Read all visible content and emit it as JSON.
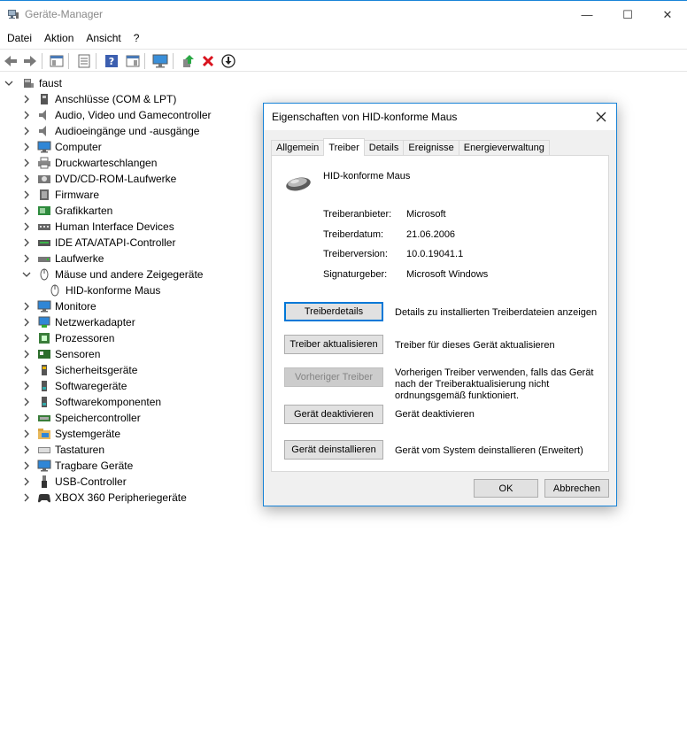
{
  "window": {
    "title": "Geräte-Manager",
    "controls": {
      "minimize": "—",
      "maximize": "☐",
      "close": "✕"
    }
  },
  "menu": [
    "Datei",
    "Aktion",
    "Ansicht",
    "?"
  ],
  "tree": {
    "root": "faust",
    "items": [
      {
        "label": "Anschlüsse (COM & LPT)",
        "icon": "port-icon"
      },
      {
        "label": "Audio, Video und Gamecontroller",
        "icon": "speaker-icon"
      },
      {
        "label": "Audioeingänge und -ausgänge",
        "icon": "speaker-icon"
      },
      {
        "label": "Computer",
        "icon": "monitor-icon"
      },
      {
        "label": "Druckwarteschlangen",
        "icon": "printer-icon"
      },
      {
        "label": "DVD/CD-ROM-Laufwerke",
        "icon": "disc-icon"
      },
      {
        "label": "Firmware",
        "icon": "chip-icon"
      },
      {
        "label": "Grafikkarten",
        "icon": "display-adapter-icon"
      },
      {
        "label": "Human Interface Devices",
        "icon": "hid-icon"
      },
      {
        "label": "IDE ATA/ATAPI-Controller",
        "icon": "ide-icon"
      },
      {
        "label": "Laufwerke",
        "icon": "drive-icon"
      },
      {
        "label": "Mäuse und andere Zeigegeräte",
        "icon": "mouse-icon",
        "expanded": true
      },
      {
        "label": "HID-konforme Maus",
        "icon": "mouse-icon",
        "child": true
      },
      {
        "label": "Monitore",
        "icon": "monitor-icon"
      },
      {
        "label": "Netzwerkadapter",
        "icon": "network-icon"
      },
      {
        "label": "Prozessoren",
        "icon": "cpu-icon"
      },
      {
        "label": "Sensoren",
        "icon": "sensor-icon"
      },
      {
        "label": "Sicherheitsgeräte",
        "icon": "security-icon"
      },
      {
        "label": "Softwaregeräte",
        "icon": "software-icon"
      },
      {
        "label": "Softwarekomponenten",
        "icon": "software-icon"
      },
      {
        "label": "Speichercontroller",
        "icon": "storage-icon"
      },
      {
        "label": "Systemgeräte",
        "icon": "folder-icon"
      },
      {
        "label": "Tastaturen",
        "icon": "keyboard-icon"
      },
      {
        "label": "Tragbare Geräte",
        "icon": "monitor-icon"
      },
      {
        "label": "USB-Controller",
        "icon": "usb-icon"
      },
      {
        "label": "XBOX 360 Peripheriegeräte",
        "icon": "gamepad-icon"
      }
    ]
  },
  "dialog": {
    "title": "Eigenschaften von HID-konforme Maus",
    "tabs": [
      "Allgemein",
      "Treiber",
      "Details",
      "Ereignisse",
      "Energieverwaltung"
    ],
    "active_tab": "Treiber",
    "device_name": "HID-konforme Maus",
    "info": [
      {
        "label": "Treiberanbieter:",
        "value": "Microsoft"
      },
      {
        "label": "Treiberdatum:",
        "value": "21.06.2006"
      },
      {
        "label": "Treiberversion:",
        "value": "10.0.19041.1"
      },
      {
        "label": "Signaturgeber:",
        "value": "Microsoft Windows"
      }
    ],
    "actions": [
      {
        "button": "Treiberdetails",
        "desc": "Details zu installierten Treiberdateien anzeigen"
      },
      {
        "button": "Treiber aktualisieren",
        "desc": "Treiber für dieses Gerät aktualisieren"
      },
      {
        "button": "Vorheriger Treiber",
        "desc": "Vorherigen Treiber verwenden, falls das Gerät nach der Treiberaktualisierung nicht ordnungsgemäß funktioniert.",
        "disabled": true
      },
      {
        "button": "Gerät deaktivieren",
        "desc": "Gerät deaktivieren"
      },
      {
        "button": "Gerät deinstallieren",
        "desc": "Gerät vom System deinstallieren (Erweitert)"
      }
    ],
    "ok": "OK",
    "cancel": "Abbrechen"
  }
}
